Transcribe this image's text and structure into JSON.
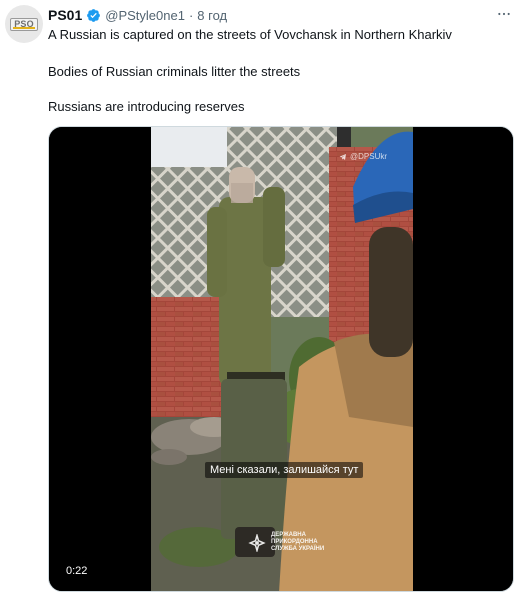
{
  "author": {
    "display_name": "PS01",
    "handle": "@PStyle0ne1",
    "separator": "·",
    "time": "8 год",
    "avatar_text": "PSO"
  },
  "tweet": {
    "lines": [
      "A Russian is captured on the streets of Vovchansk in Northern Kharkiv",
      "Bodies of Russian criminals litter the streets",
      "Russians are introducing reserves"
    ]
  },
  "more_icon": "more-horizontal-icon",
  "verified_icon": "verified-badge-icon",
  "verified_color": "#1d9bf0",
  "video": {
    "watermark": "@DPSUkr",
    "caption": "Мені сказали, залишайся тут",
    "agency_lines": [
      "ДЕРЖАВНА",
      "ПРИКОРДОННА",
      "СЛУЖБА УКРАЇНИ"
    ],
    "duration": "0:22"
  }
}
